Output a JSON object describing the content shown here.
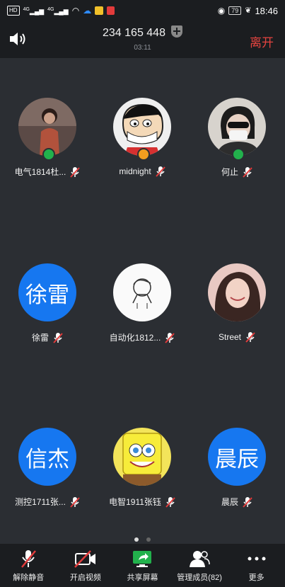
{
  "status_bar": {
    "hd_label": "HD",
    "signal1_label": "4G",
    "signal2_label": "4G",
    "battery_level": "79",
    "time": "18:46"
  },
  "header": {
    "meeting_id": "234 165 448",
    "elapsed_time": "03:11",
    "leave_label": "离开"
  },
  "participants": [
    {
      "name": "电气1814杜...",
      "role_badge_color": "#22b14c",
      "avatar_type": "photo"
    },
    {
      "name": "midnight",
      "role_badge_color": "#f29d1f",
      "avatar_type": "photo"
    },
    {
      "name": "何止",
      "role_badge_color": "#22b14c",
      "avatar_type": "photo"
    },
    {
      "name": "徐雷",
      "avatar_text": "徐雷",
      "avatar_type": "text"
    },
    {
      "name": "自动化1812...",
      "avatar_type": "photo"
    },
    {
      "name": "Street ",
      "avatar_type": "photo"
    },
    {
      "name": "测控1711张...",
      "avatar_text": "信杰",
      "avatar_type": "text"
    },
    {
      "name": "电智1911张钰",
      "avatar_type": "photo"
    },
    {
      "name": "晨辰",
      "avatar_text": "晨辰",
      "avatar_type": "text"
    }
  ],
  "pager": {
    "page_count": 2,
    "current_page": 1
  },
  "toolbar": {
    "unmute_label": "解除静音",
    "video_label": "开启视频",
    "share_label": "共享屏幕",
    "members_label": "管理成员(82)",
    "more_label": "更多"
  },
  "colors": {
    "accent_blue": "#1677f0",
    "leave_red": "#e4443f",
    "share_green": "#22b14c",
    "mute_red": "#e23b3b"
  }
}
